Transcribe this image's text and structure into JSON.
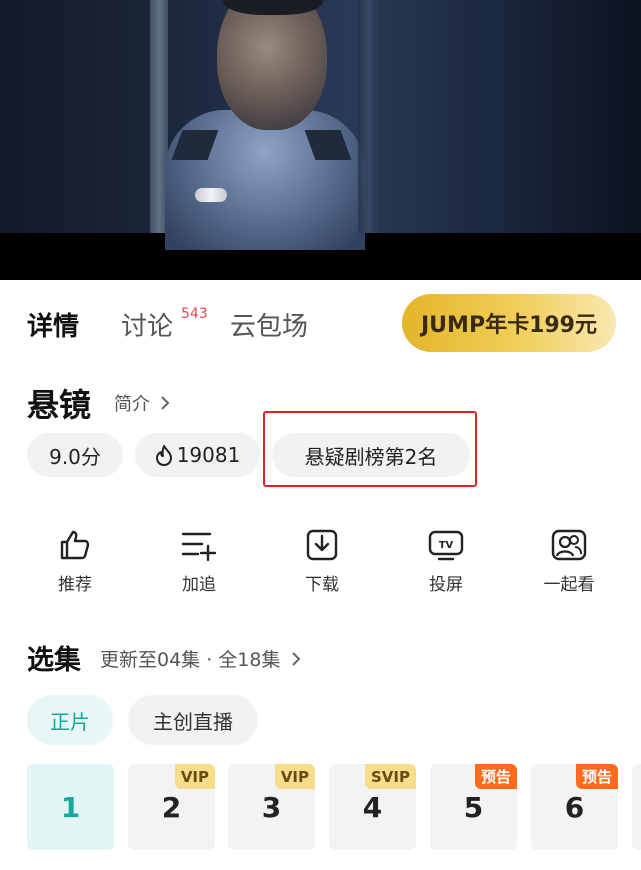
{
  "tabs": [
    {
      "label": "详情"
    },
    {
      "label": "讨论",
      "badge": "543"
    },
    {
      "label": "云包场"
    }
  ],
  "promo": {
    "label": "JUMP年卡199元"
  },
  "show": {
    "title": "悬镜",
    "intro_label": "简介",
    "score": "9.0分",
    "heat": "19081",
    "rank": "悬疑剧榜第2名"
  },
  "actions": [
    {
      "label": "推荐",
      "icon": "thumbs-up-icon"
    },
    {
      "label": "加追",
      "icon": "add-to-list-icon"
    },
    {
      "label": "下载",
      "icon": "download-icon"
    },
    {
      "label": "投屏",
      "icon": "tv-cast-icon"
    },
    {
      "label": "一起看",
      "icon": "watch-together-icon"
    }
  ],
  "episodes": {
    "section_title": "选集",
    "update_info": "更新至04集 · 全18集",
    "segments": [
      {
        "label": "正片",
        "selected": true
      },
      {
        "label": "主创直播",
        "selected": false
      }
    ],
    "items": [
      {
        "number": "1",
        "tag": "",
        "selected": true
      },
      {
        "number": "2",
        "tag": "VIP"
      },
      {
        "number": "3",
        "tag": "VIP"
      },
      {
        "number": "4",
        "tag": "SVIP"
      },
      {
        "number": "5",
        "tag": "预告"
      },
      {
        "number": "6",
        "tag": "预告"
      }
    ]
  },
  "colors": {
    "accent": "#19a8a0",
    "highlight_border": "#e02323",
    "promo_gold": "#e3b52a",
    "preview_tag": "#ff6a1f",
    "vip_tag": "#f6dd8c",
    "badge_red": "#e8474c"
  }
}
